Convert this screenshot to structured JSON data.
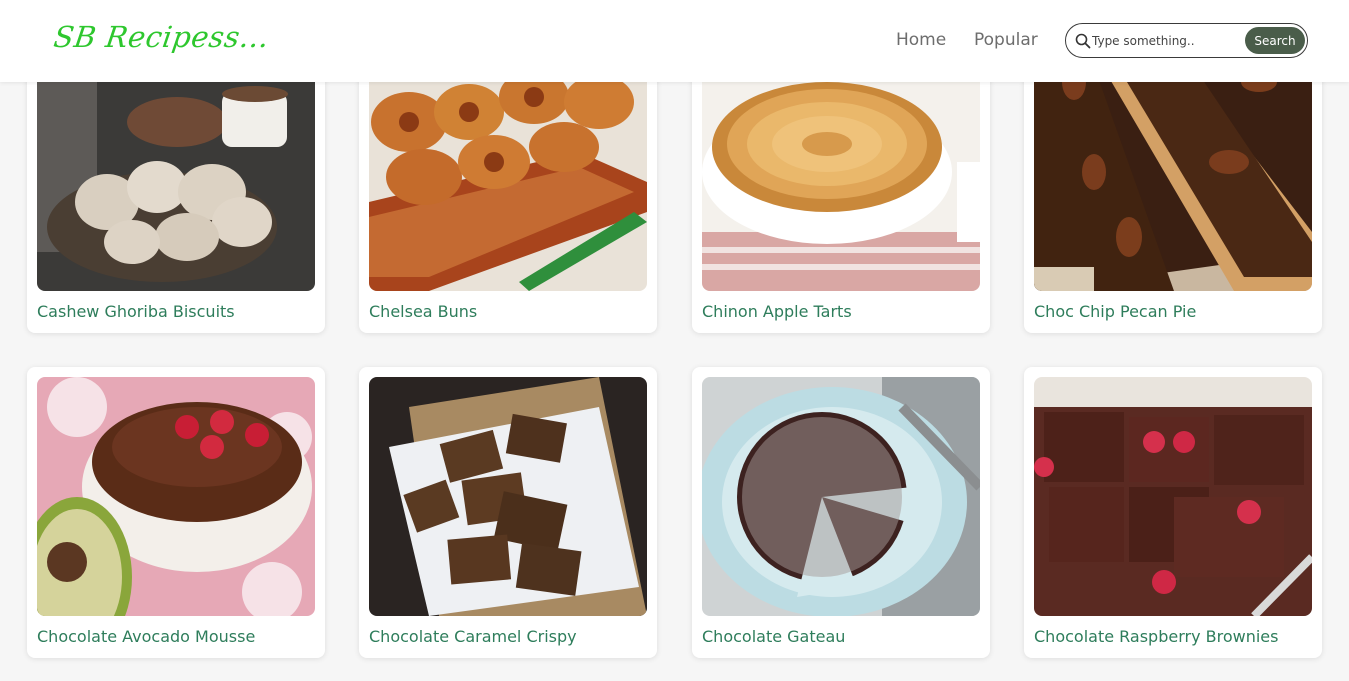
{
  "header": {
    "logo": "SB Recipess...",
    "nav": [
      {
        "label": "Home"
      },
      {
        "label": "Popular"
      }
    ],
    "search": {
      "placeholder": "Type something..",
      "button_label": "Search"
    }
  },
  "recipes": [
    {
      "title": "Cashew Ghoriba Biscuits"
    },
    {
      "title": "Chelsea Buns"
    },
    {
      "title": "Chinon Apple Tarts"
    },
    {
      "title": "Choc Chip Pecan Pie"
    },
    {
      "title": "Chocolate Avocado Mousse"
    },
    {
      "title": "Chocolate Caramel Crispy"
    },
    {
      "title": "Chocolate Gateau"
    },
    {
      "title": "Chocolate Raspberry Brownies"
    }
  ]
}
